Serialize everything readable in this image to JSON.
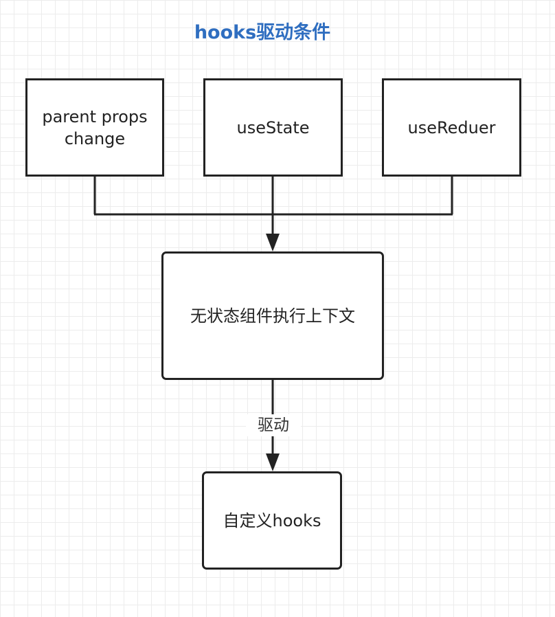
{
  "title": "hooks驱动条件",
  "nodes": {
    "parent_props": "parent props change",
    "use_state": "useState",
    "use_reducer": "useReduer",
    "context": "无状态组件执行上下文",
    "custom_hooks": "自定义hooks"
  },
  "edges": {
    "drive_label": "驱动"
  },
  "colors": {
    "title": "#2f6ec0",
    "stroke": "#222222",
    "grid": "#ececec"
  }
}
